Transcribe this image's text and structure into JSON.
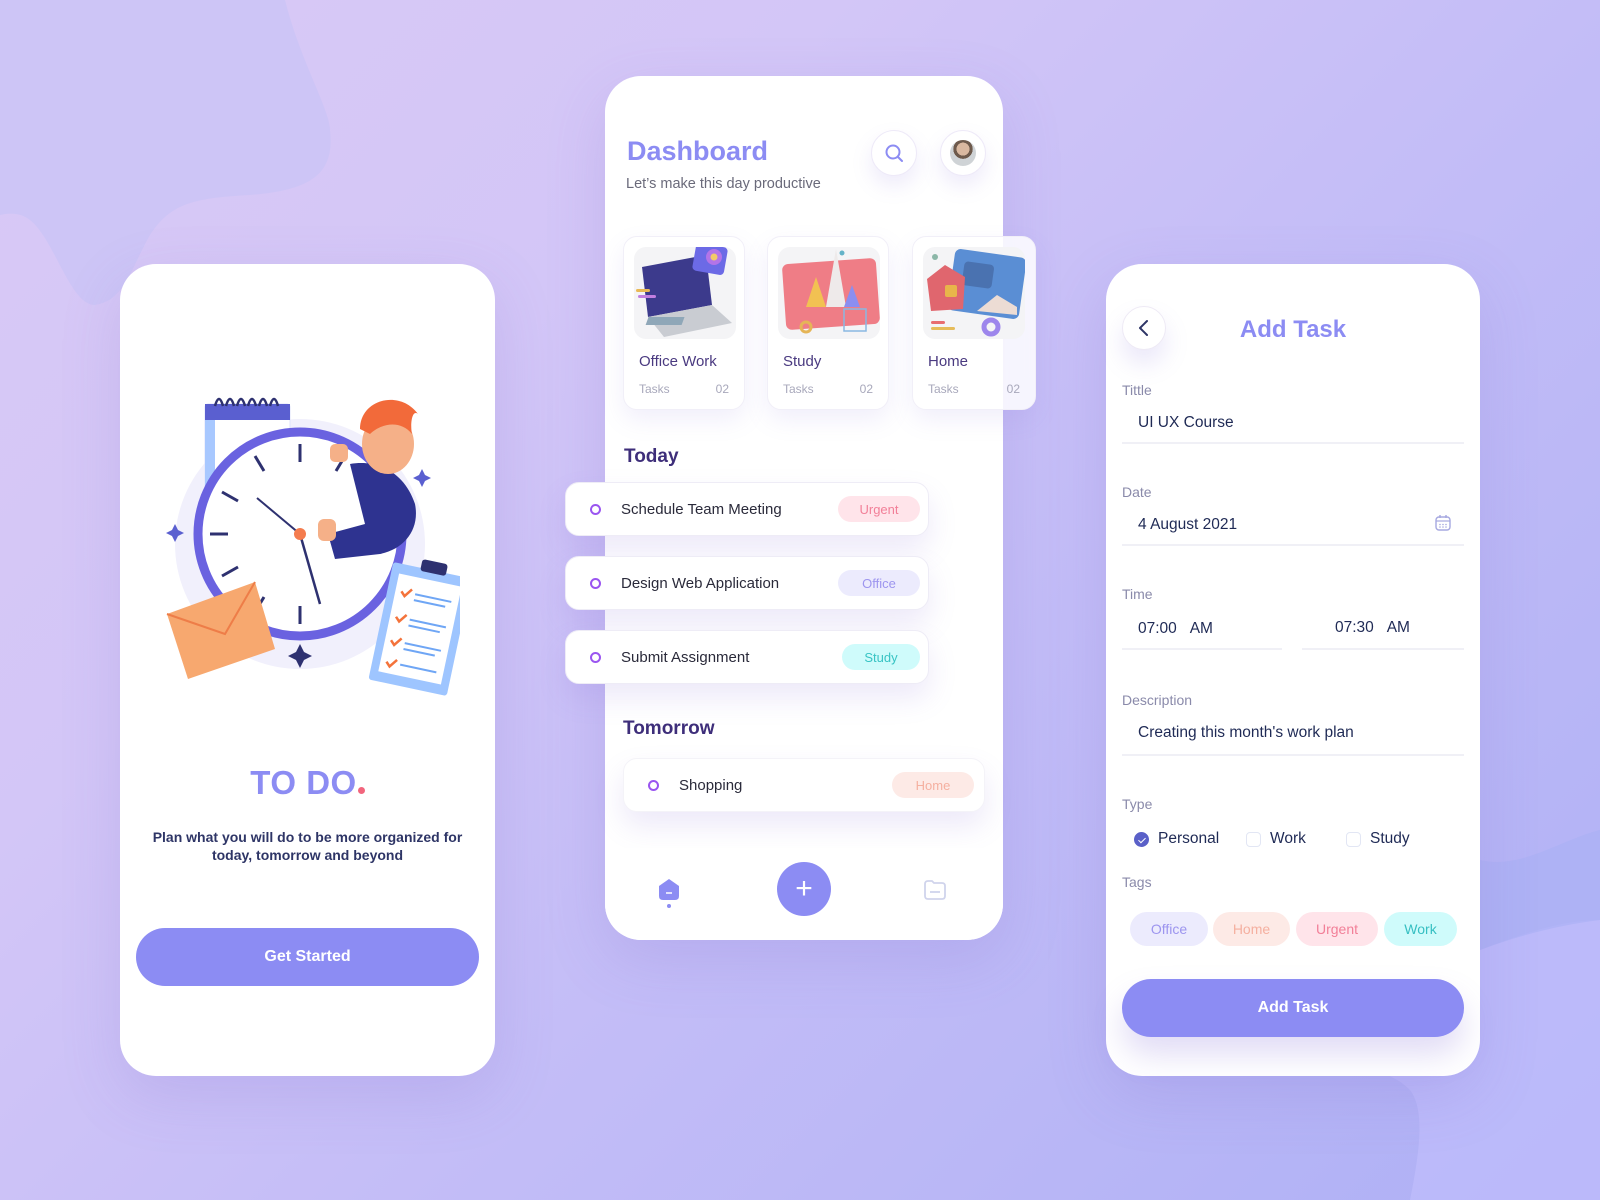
{
  "theme": {
    "accent": "#8c8cf3",
    "dark_text": "#2e3566",
    "heading_purple": "#3e2e7a",
    "ring_purple": "#9a55f0",
    "urgent_color": "#f27f98",
    "office_color": "#9d95ef",
    "study_color": "#38c4c4",
    "home_color": "#f5b0a0"
  },
  "welcome": {
    "title": "TO DO",
    "subtitle": "Plan what you will do to be more organized for today, tomorrow and beyond",
    "cta": "Get Started",
    "illustration": "clock-person-illustration"
  },
  "dashboard": {
    "title": "Dashboard",
    "subtitle": "Let’s make this day productive",
    "search_icon": "search-icon",
    "avatar": "user-avatar",
    "categories": [
      {
        "name": "Office Work",
        "tasks_label": "Tasks",
        "count": "02",
        "image": "laptop-3d"
      },
      {
        "name": "Study",
        "tasks_label": "Tasks",
        "count": "02",
        "image": "pyramid-chart-3d"
      },
      {
        "name": "Home",
        "tasks_label": "Tasks",
        "count": "02",
        "image": "house-window-3d"
      }
    ],
    "sections": {
      "today": "Today",
      "tomorrow": "Tomorrow"
    },
    "today_tasks": [
      {
        "title": "Schedule Team Meeting",
        "tag": "Urgent"
      },
      {
        "title": "Design Web Application",
        "tag": "Office"
      },
      {
        "title": "Submit Assignment",
        "tag": "Study"
      }
    ],
    "tomorrow_tasks": [
      {
        "title": "Shopping",
        "tag": "Home"
      }
    ],
    "nav": {
      "home_icon": "home-icon",
      "add_icon": "plus-icon",
      "add_label": "+",
      "folder_icon": "folder-icon"
    }
  },
  "add_task": {
    "title": "Add Task",
    "back_icon": "chevron-left-icon",
    "fields": {
      "title_label": "Tittle",
      "title_value": "UI UX Course",
      "date_label": "Date",
      "date_value": "4 August 2021",
      "time_label": "Time",
      "start_time": "07:00",
      "start_period": "AM",
      "end_time": "07:30",
      "end_period": "AM",
      "description_label": "Description",
      "description_value": "Creating this month's work plan"
    },
    "type": {
      "label": "Type",
      "options": [
        {
          "label": "Personal",
          "checked": true
        },
        {
          "label": "Work",
          "checked": false
        },
        {
          "label": "Study",
          "checked": false
        }
      ]
    },
    "tags": {
      "label": "Tags",
      "items": [
        "Office",
        "Home",
        "Urgent",
        "Work"
      ]
    },
    "submit": "Add Task"
  }
}
